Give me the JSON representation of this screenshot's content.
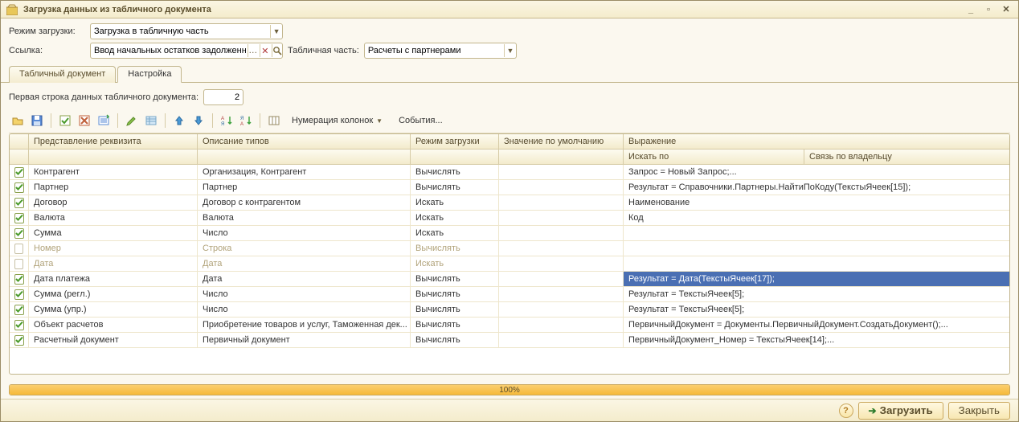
{
  "title": "Загрузка данных из табличного документа",
  "form": {
    "mode_label": "Режим загрузки:",
    "mode_value": "Загрузка в табличную часть",
    "ref_label": "Ссылка:",
    "ref_value": "Ввод начальных остатков задолженно",
    "tabpart_label": "Табличная часть:",
    "tabpart_value": "Расчеты с партнерами"
  },
  "tabs": {
    "tab1": "Табличный документ",
    "tab2": "Настройка"
  },
  "firstline": {
    "label": "Первая строка данных табличного документа:",
    "value": "2"
  },
  "toolbar": {
    "numbering": "Нумерация колонок",
    "events": "События..."
  },
  "columns": {
    "c0": "",
    "c1": "Представление реквизита",
    "c2": "Описание типов",
    "c3": "Режим загрузки",
    "c4": "Значение по умолчанию",
    "c5": "Выражение",
    "c5a": "Искать по",
    "c5b": "Связь по владельцу"
  },
  "rows": [
    {
      "ck": true,
      "name": "Контрагент",
      "types": "Организация, Контрагент",
      "mode": "Вычислять",
      "def": "",
      "expr": "Запрос = Новый Запрос;..."
    },
    {
      "ck": true,
      "name": "Партнер",
      "types": "Партнер",
      "mode": "Вычислять",
      "def": "",
      "expr": "Результат = Справочники.Партнеры.НайтиПоКоду(ТекстыЯчеек[15]);"
    },
    {
      "ck": true,
      "name": "Договор",
      "types": "Договор с контрагентом",
      "mode": "Искать",
      "def": "",
      "expr": "Наименование"
    },
    {
      "ck": true,
      "name": "Валюта",
      "types": "Валюта",
      "mode": "Искать",
      "def": "",
      "expr": "Код"
    },
    {
      "ck": true,
      "name": "Сумма",
      "types": "Число",
      "mode": "Искать",
      "def": "",
      "expr": ""
    },
    {
      "ck": false,
      "disabled": true,
      "name": "Номер",
      "types": "Строка",
      "mode": "Вычислять",
      "def": "",
      "expr": ""
    },
    {
      "ck": false,
      "disabled": true,
      "name": "Дата",
      "types": "Дата",
      "mode": "Искать",
      "def": "",
      "expr": ""
    },
    {
      "ck": true,
      "name": "Дата платежа",
      "types": "Дата",
      "mode": "Вычислять",
      "def": "",
      "expr": "Результат           = Дата(ТекстыЯчеек[17]);",
      "selected": true
    },
    {
      "ck": true,
      "name": "Сумма (регл.)",
      "types": "Число",
      "mode": "Вычислять",
      "def": "",
      "expr": "Результат =  ТекстыЯчеек[5];"
    },
    {
      "ck": true,
      "name": "Сумма (упр.)",
      "types": "Число",
      "mode": "Вычислять",
      "def": "",
      "expr": "Результат =  ТекстыЯчеек[5];"
    },
    {
      "ck": true,
      "name": "Объект расчетов",
      "types": "Приобретение товаров и услуг, Таможенная дек...",
      "mode": "Вычислять",
      "def": "",
      "expr": "ПервичныйДокумент = Документы.ПервичныйДокумент.СоздатьДокумент();..."
    },
    {
      "ck": true,
      "name": "Расчетный документ",
      "types": "Первичный документ",
      "mode": "Вычислять",
      "def": "",
      "expr": "ПервичныйДокумент_Номер = ТекстыЯчеек[14];..."
    }
  ],
  "progress": "100%",
  "footer": {
    "load": "Загрузить",
    "close": "Закрыть"
  }
}
